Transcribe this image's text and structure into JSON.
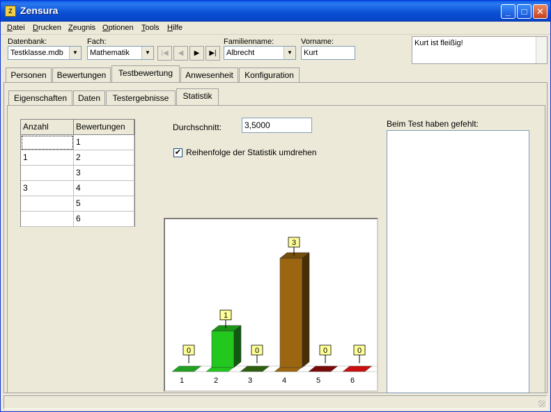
{
  "window": {
    "title": "Zensura",
    "icon_text": "Z"
  },
  "menu": {
    "items": [
      {
        "underline": "D",
        "rest": "atei"
      },
      {
        "underline": "D",
        "rest": "rucken"
      },
      {
        "underline": "Z",
        "rest": "eugnis"
      },
      {
        "underline": "O",
        "rest": "ptionen"
      },
      {
        "underline": "T",
        "rest": "ools"
      },
      {
        "underline": "H",
        "rest": "ilfe"
      }
    ]
  },
  "toolbar": {
    "db_label": "Datenbank:",
    "db_value": "Testklasse.mdb",
    "subject_label": "Fach:",
    "subject_value": "Mathematik",
    "lastname_label": "Familienname:",
    "lastname_value": "Albrecht",
    "firstname_label": "Vorname:",
    "firstname_value": "Kurt",
    "nav": [
      "|◀",
      "◀",
      "▶",
      "▶|"
    ],
    "memo_text": "Kurt ist fleißig!"
  },
  "tabs_main": [
    "Personen",
    "Bewertungen",
    "Testbewertung",
    "Anwesenheit",
    "Konfiguration"
  ],
  "tabs_sub": [
    "Eigenschaften",
    "Daten",
    "Testergebnisse",
    "Statistik"
  ],
  "grid": {
    "headers": [
      "Anzahl",
      "Bewertungen"
    ],
    "rows": [
      [
        "",
        "1"
      ],
      [
        "1",
        "2"
      ],
      [
        "",
        "3"
      ],
      [
        "3",
        "4"
      ],
      [
        "",
        "5"
      ],
      [
        "",
        "6"
      ]
    ]
  },
  "stats": {
    "average_label": "Durchschnitt:",
    "average_value": "3,5000",
    "reverse_label": "Reihenfolge der Statistik umdrehen",
    "reverse_checked": true,
    "absent_label": "Beim Test haben gefehlt:"
  },
  "chart_data": {
    "type": "bar",
    "categories": [
      "1",
      "2",
      "3",
      "4",
      "5",
      "6"
    ],
    "values": [
      0,
      1,
      0,
      3,
      0,
      0
    ],
    "colors": [
      "#22a022",
      "#22c81e",
      "#2e5e10",
      "#9c6610",
      "#7a0a0a",
      "#c81010"
    ],
    "ylim": [
      0,
      3
    ]
  }
}
